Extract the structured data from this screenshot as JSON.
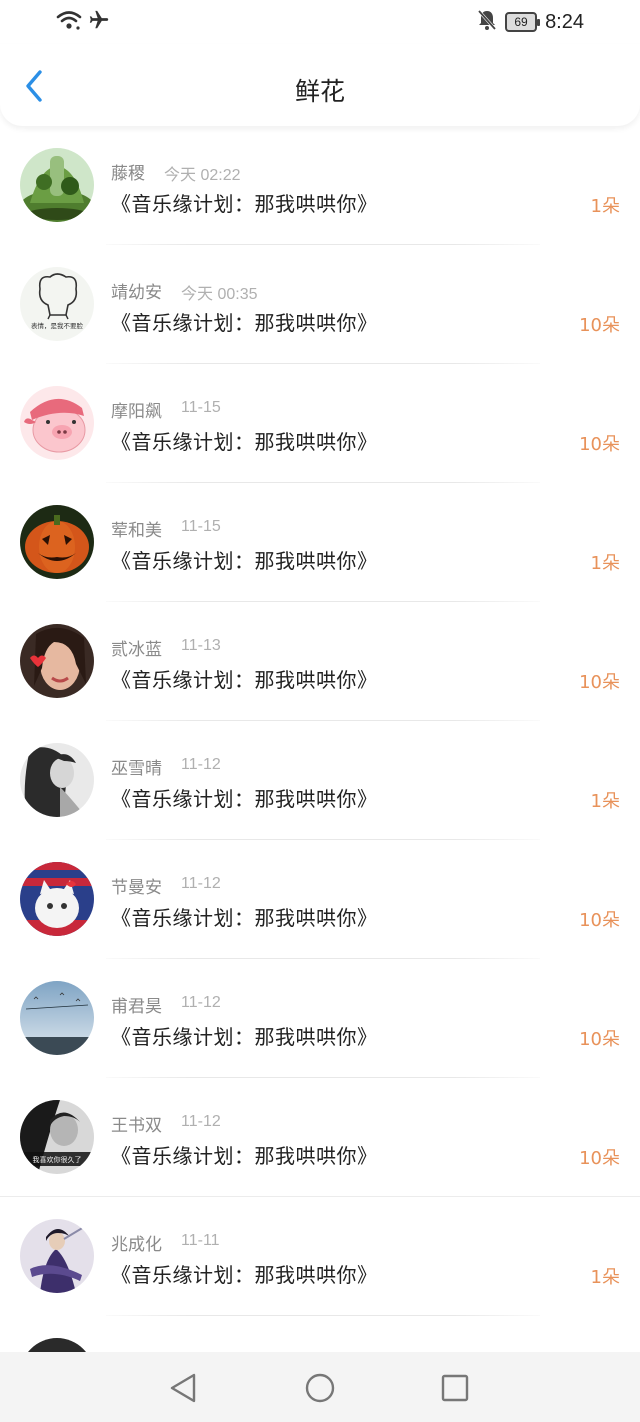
{
  "status_bar": {
    "time": "8:24",
    "battery": "69",
    "icons": [
      "wifi-icon",
      "airplane-icon",
      "bell-muted-icon",
      "battery-icon"
    ]
  },
  "header": {
    "title": "鲜花",
    "back_icon": "chevron-left-icon",
    "accent": "#2b8fe6"
  },
  "items": [
    {
      "name": "藤稷",
      "time": "今天 02:22",
      "song": "《音乐缘计划：那我哄哄你》",
      "count": "1朵"
    },
    {
      "name": "靖幼安",
      "time": "今天 00:35",
      "song": "《音乐缘计划：那我哄哄你》",
      "count": "10朵"
    },
    {
      "name": "摩阳飙",
      "time": "11-15",
      "song": "《音乐缘计划：那我哄哄你》",
      "count": "10朵"
    },
    {
      "name": "荤和美",
      "time": "11-15",
      "song": "《音乐缘计划：那我哄哄你》",
      "count": "1朵"
    },
    {
      "name": "贰冰蓝",
      "time": "11-13",
      "song": "《音乐缘计划：那我哄哄你》",
      "count": "10朵"
    },
    {
      "name": "巫雪晴",
      "time": "11-12",
      "song": "《音乐缘计划：那我哄哄你》",
      "count": "1朵"
    },
    {
      "name": "节曼安",
      "time": "11-12",
      "song": "《音乐缘计划：那我哄哄你》",
      "count": "10朵"
    },
    {
      "name": "甫君昊",
      "time": "11-12",
      "song": "《音乐缘计划：那我哄哄你》",
      "count": "10朵"
    },
    {
      "name": "王书双",
      "time": "11-12",
      "song": "《音乐缘计划：那我哄哄你》",
      "count": "10朵"
    },
    {
      "name": "兆成化",
      "time": "11-11",
      "song": "《音乐缘计划：那我哄哄你》",
      "count": "1朵"
    }
  ],
  "avatar_captions": {
    "item2": "表情，是我不要脸",
    "item9": "我喜欢你很久了"
  },
  "count_color": "#e8925a",
  "nav_bar": {
    "icons": [
      "back-triangle-icon",
      "home-circle-icon",
      "recents-square-icon"
    ]
  }
}
